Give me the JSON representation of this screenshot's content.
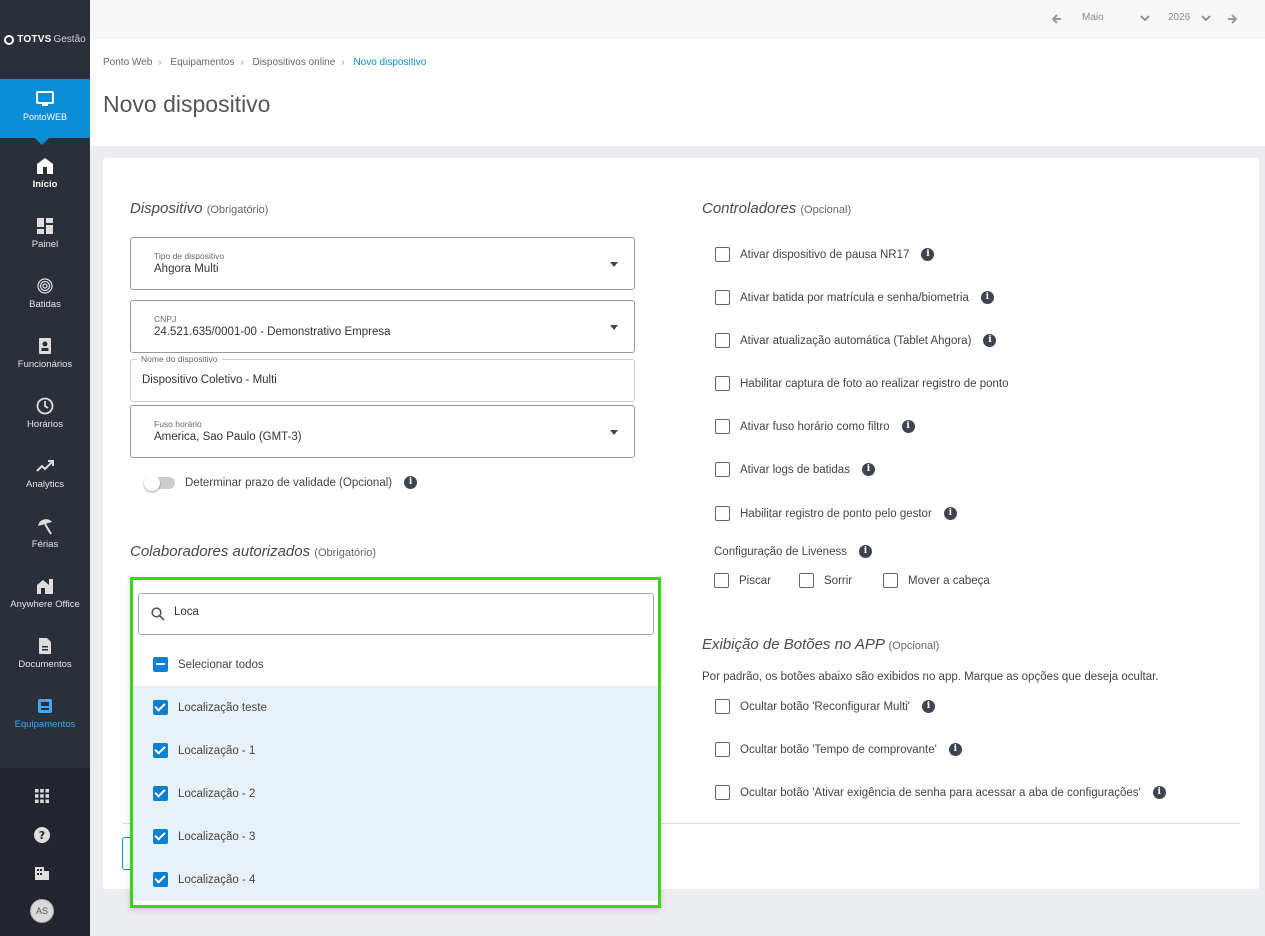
{
  "brand": {
    "bold": "TOTVS",
    "light": "Gestão"
  },
  "module": {
    "label": "PontoWEB",
    "icon": "monitor-icon"
  },
  "nav": [
    {
      "label": "Início",
      "icon": "home-icon"
    },
    {
      "label": "Painel",
      "icon": "dashboard-icon"
    },
    {
      "label": "Batidas",
      "icon": "fingerprint-icon"
    },
    {
      "label": "Funcionários",
      "icon": "badge-icon"
    },
    {
      "label": "Horários",
      "icon": "clock-icon"
    },
    {
      "label": "Analytics",
      "icon": "trending-up-icon"
    },
    {
      "label": "Férias",
      "icon": "beach-umbrella-icon"
    },
    {
      "label": "Anywhere Office",
      "icon": "home-work-icon"
    },
    {
      "label": "Documentos",
      "icon": "document-icon"
    },
    {
      "label": "Equipamentos",
      "icon": "device-icon"
    }
  ],
  "user": {
    "initials": "AS"
  },
  "period": {
    "month": "Maio",
    "year": "2026"
  },
  "breadcrumb": [
    "Ponto Web",
    "Equipamentos",
    "Dispositivos online",
    "Novo dispositivo"
  ],
  "page": {
    "title": "Novo dispositivo"
  },
  "device": {
    "title": "Dispositivo",
    "required": "(Obrigatório)",
    "type": {
      "label": "Tipo de dispositivo",
      "value": "Ahgora Multi"
    },
    "cnpj": {
      "label": "CNPJ",
      "value": "24.521.635/0001-00 - Demonstrativo Empresa"
    },
    "name": {
      "label": "Nome do dispositivo",
      "value": "Dispositivo Coletivo - Multi"
    },
    "timezone": {
      "label": "Fuso horário",
      "value": "America, Sao Paulo (GMT-3)"
    },
    "validity_toggle": "Determinar prazo de validade (Opcional)"
  },
  "collaborators": {
    "title": "Colaboradores autorizados",
    "required": "(Obrigatório)",
    "search_value": "Loca",
    "select_all": "Selecionar todos",
    "options": [
      "Localização teste",
      "Localização - 1",
      "Localização - 2",
      "Localização - 3",
      "Localização - 4"
    ]
  },
  "controllers": {
    "title": "Controladores",
    "optional": "(Opcional)",
    "items": [
      "Ativar dispositivo de pausa NR17",
      "Ativar batida por matrícula e senha/biometria",
      "Ativar atualização automática (Tablet Ahgora)",
      "Habilitar captura de foto ao realizar registro de ponto",
      "Ativar fuso horário como filtro",
      "Ativar logs de batidas",
      "Habilitar registro de ponto pelo gestor"
    ],
    "liveness_label": "Configuração de Liveness",
    "liveness_options": [
      "Piscar",
      "Sorrir",
      "Mover a cabeça"
    ]
  },
  "app_buttons": {
    "title": "Exibição de Botões no APP",
    "optional": "(Opcional)",
    "description": "Por padrão, os botões abaixo são exibidos no app. Marque as opções que deseja ocultar.",
    "items": [
      "Ocultar botão 'Reconfigurar Multi'",
      "Ocultar botão 'Tempo de comprovante'",
      "Ocultar botão 'Ativar exigência de senha para acessar a aba de configurações'"
    ]
  }
}
